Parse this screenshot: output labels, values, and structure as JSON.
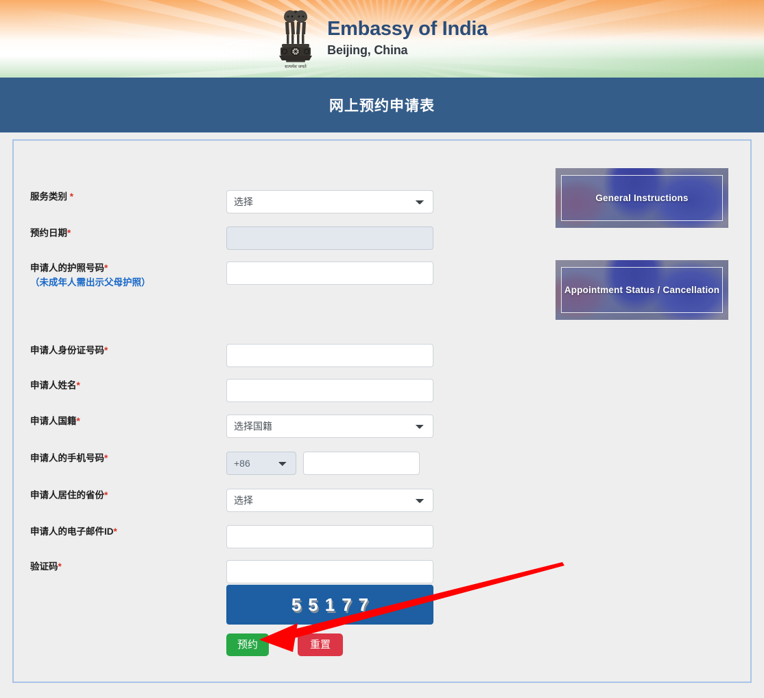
{
  "header": {
    "emblem_icon": "india-state-emblem-icon",
    "title": "Embassy of India",
    "subtitle": "Beijing, China"
  },
  "titlebar": {
    "title": "网上预约申请表"
  },
  "form": {
    "fields": [
      {
        "label": "服务类别",
        "required_mark": " *",
        "control": "select",
        "value": "选择"
      },
      {
        "label": "预约日期",
        "required_mark": "*",
        "control": "input-disabled",
        "value": ""
      },
      {
        "label": "申请人的护照号码",
        "required_mark": "*",
        "note": "（未成年人需出示父母护照）",
        "control": "input",
        "value": ""
      },
      {
        "label": "申请人身份证号码",
        "required_mark": "*",
        "control": "input",
        "value": ""
      },
      {
        "label": "申请人姓名",
        "required_mark": "*",
        "control": "input",
        "value": ""
      },
      {
        "label": "申请人国籍",
        "required_mark": "*",
        "control": "select",
        "value": "选择国籍"
      },
      {
        "label": "申请人的手机号码",
        "required_mark": "*",
        "control": "phone",
        "country_code": "+86",
        "value": ""
      },
      {
        "label": "申请人居住的省份",
        "required_mark": "*",
        "control": "select",
        "value": "选择"
      },
      {
        "label": "申请人的电子邮件ID",
        "required_mark": "*",
        "control": "input",
        "value": ""
      },
      {
        "label": "验证码",
        "required_mark": "*",
        "control": "captcha",
        "value": ""
      }
    ],
    "captcha_code": "55177",
    "submit_label": "预约",
    "reset_label": "重置"
  },
  "side_banners": [
    {
      "label": "General Instructions"
    },
    {
      "label": "Appointment Status / Cancellation"
    }
  ],
  "annotation": {
    "arrow_color": "#FF0000",
    "points_to": "预约"
  },
  "colors": {
    "title_bar": "#355D8A",
    "card_border": "#A8C4E5",
    "page_background": "#EEEEEE",
    "submit_green": "#28A745",
    "reset_red": "#DC3545",
    "captcha_blue": "#1D5FA2",
    "required_red": "#D93025",
    "note_blue": "#1868C8",
    "saffron": "#F9A85F",
    "india_green": "#96CE96"
  }
}
